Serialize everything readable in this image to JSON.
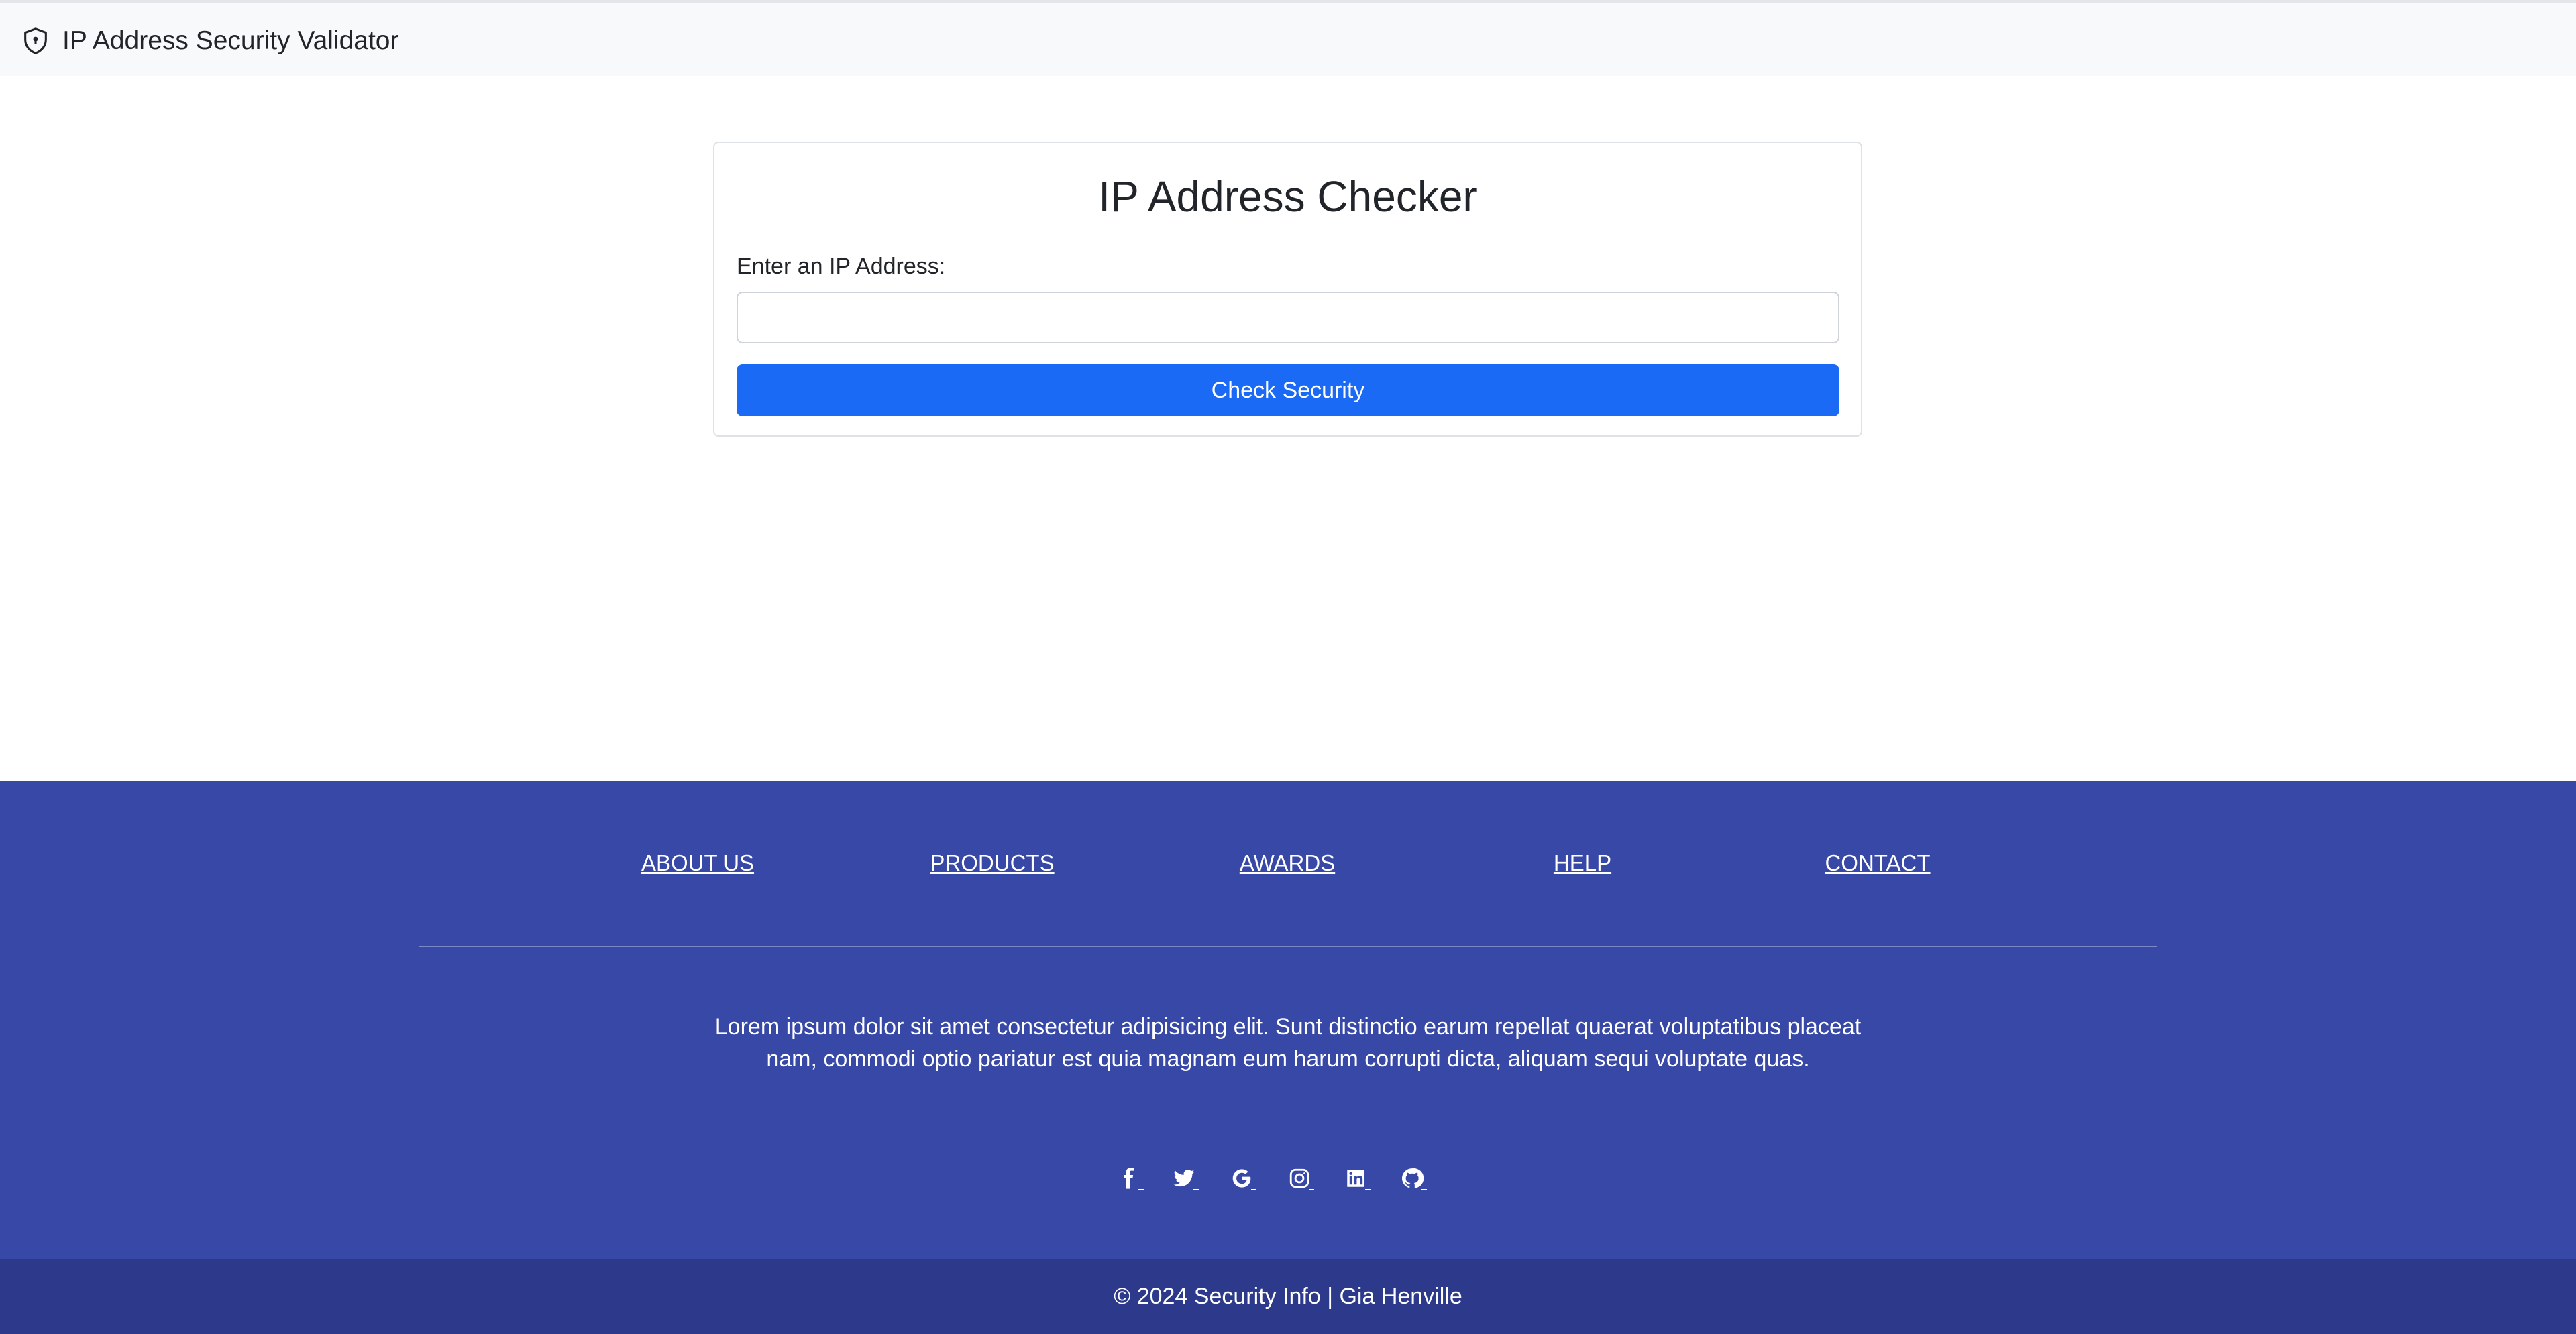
{
  "navbar": {
    "title": "IP Address Security Validator",
    "icon": "shield-lock-icon"
  },
  "checker": {
    "title": "IP Address Checker",
    "field_label": "Enter an IP Address:",
    "input_value": "",
    "button_label": "Check Security"
  },
  "footer": {
    "links": [
      "ABOUT US",
      "PRODUCTS",
      "AWARDS",
      "HELP",
      "CONTACT"
    ],
    "description": "Lorem ipsum dolor sit amet consectetur adipisicing elit. Sunt distinctio earum repellat quaerat voluptatibus placeat nam, commodi optio pariatur est quia magnam eum harum corrupti dicta, aliquam sequi voluptate quas.",
    "social_icons": [
      "facebook-icon",
      "twitter-icon",
      "google-icon",
      "instagram-icon",
      "linkedin-icon",
      "github-icon"
    ],
    "copyright": "© 2024 Security Info | Gia Henville"
  },
  "colors": {
    "primary_button": "#1a6af5",
    "footer_bg": "#3848a7",
    "copyright_bg": "#2d3a8c",
    "navbar_bg": "#f8f9fa"
  }
}
